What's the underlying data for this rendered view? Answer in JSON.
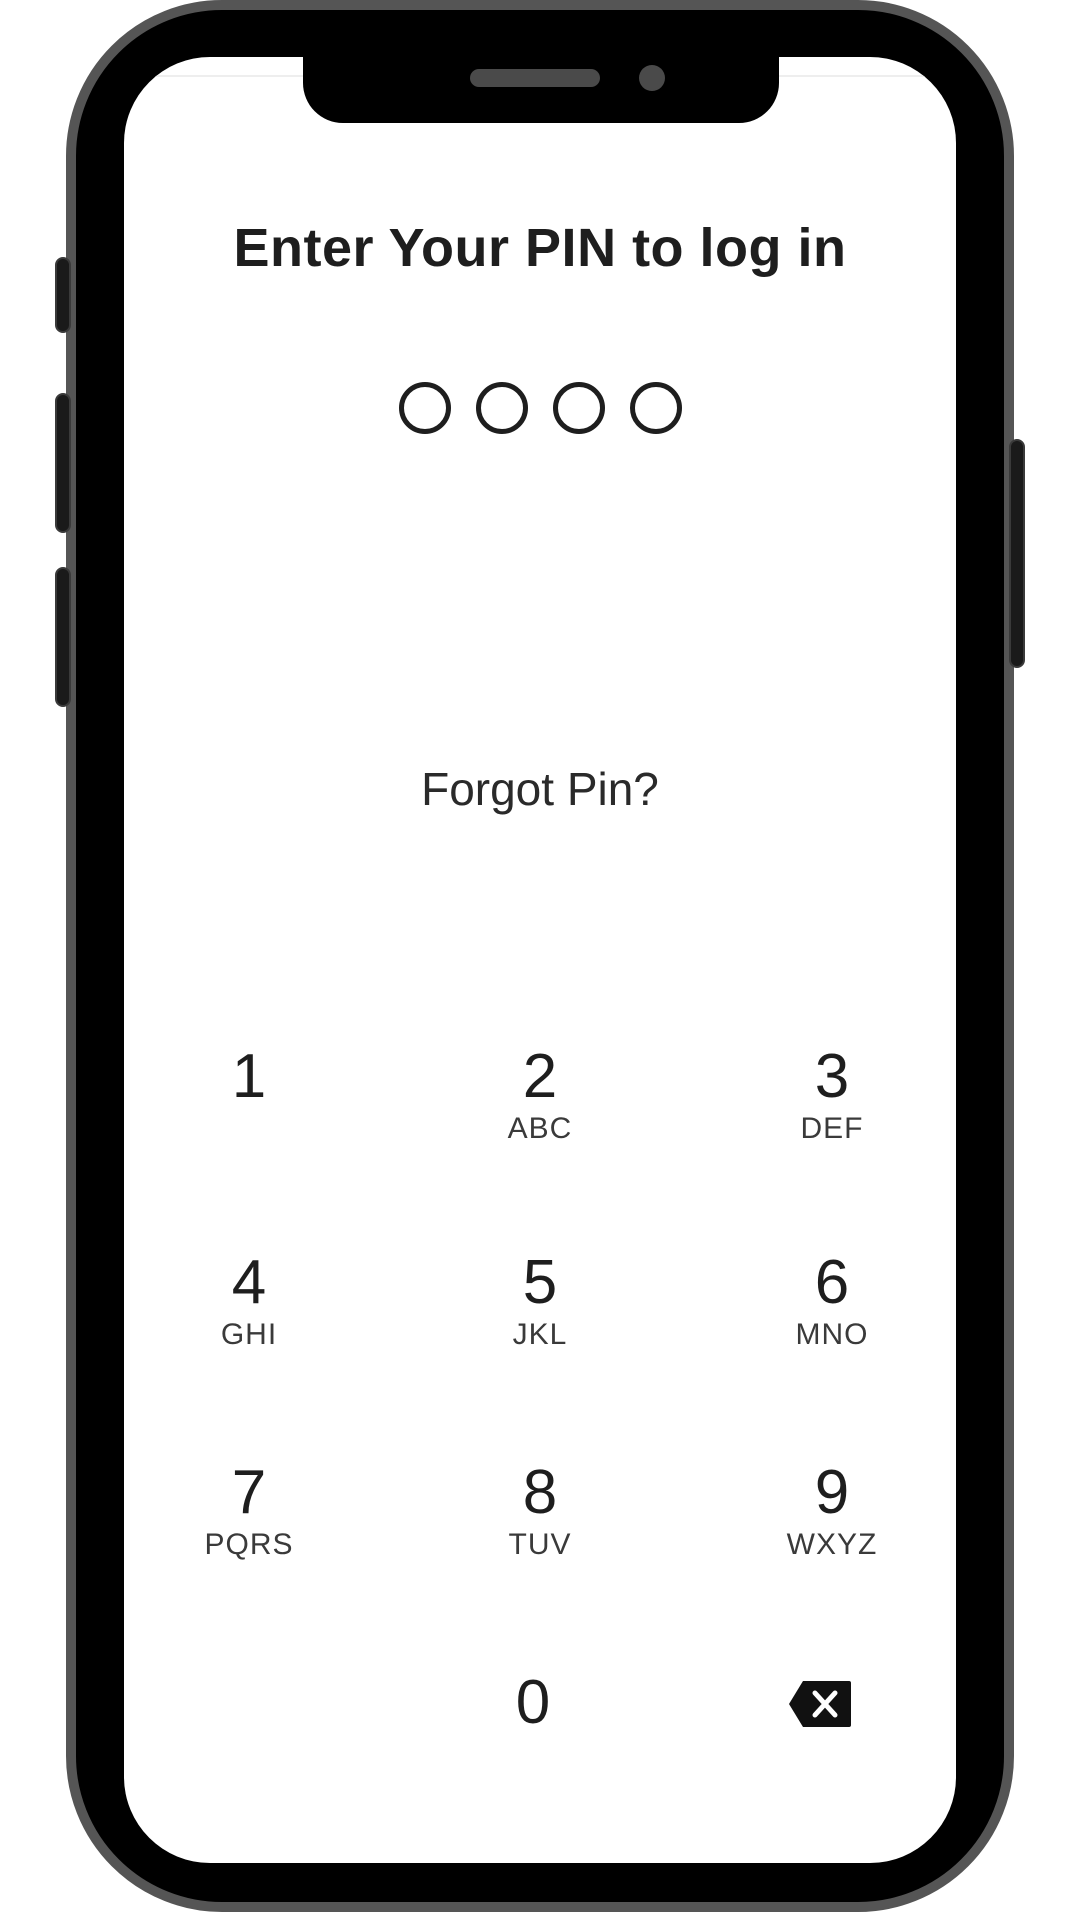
{
  "login": {
    "title": "Enter Your PIN to log in",
    "pin_length": 4,
    "pin_entered": 0,
    "forgot_label": "Forgot Pin?"
  },
  "keypad": {
    "keys": [
      {
        "digit": "1",
        "letters": ""
      },
      {
        "digit": "2",
        "letters": "ABC"
      },
      {
        "digit": "3",
        "letters": "DEF"
      },
      {
        "digit": "4",
        "letters": "GHI"
      },
      {
        "digit": "5",
        "letters": "JKL"
      },
      {
        "digit": "6",
        "letters": "MNO"
      },
      {
        "digit": "7",
        "letters": "PQRS"
      },
      {
        "digit": "8",
        "letters": "TUV"
      },
      {
        "digit": "9",
        "letters": "WXYZ"
      },
      {
        "digit": "0",
        "letters": ""
      }
    ],
    "backspace_icon": "backspace-icon"
  }
}
